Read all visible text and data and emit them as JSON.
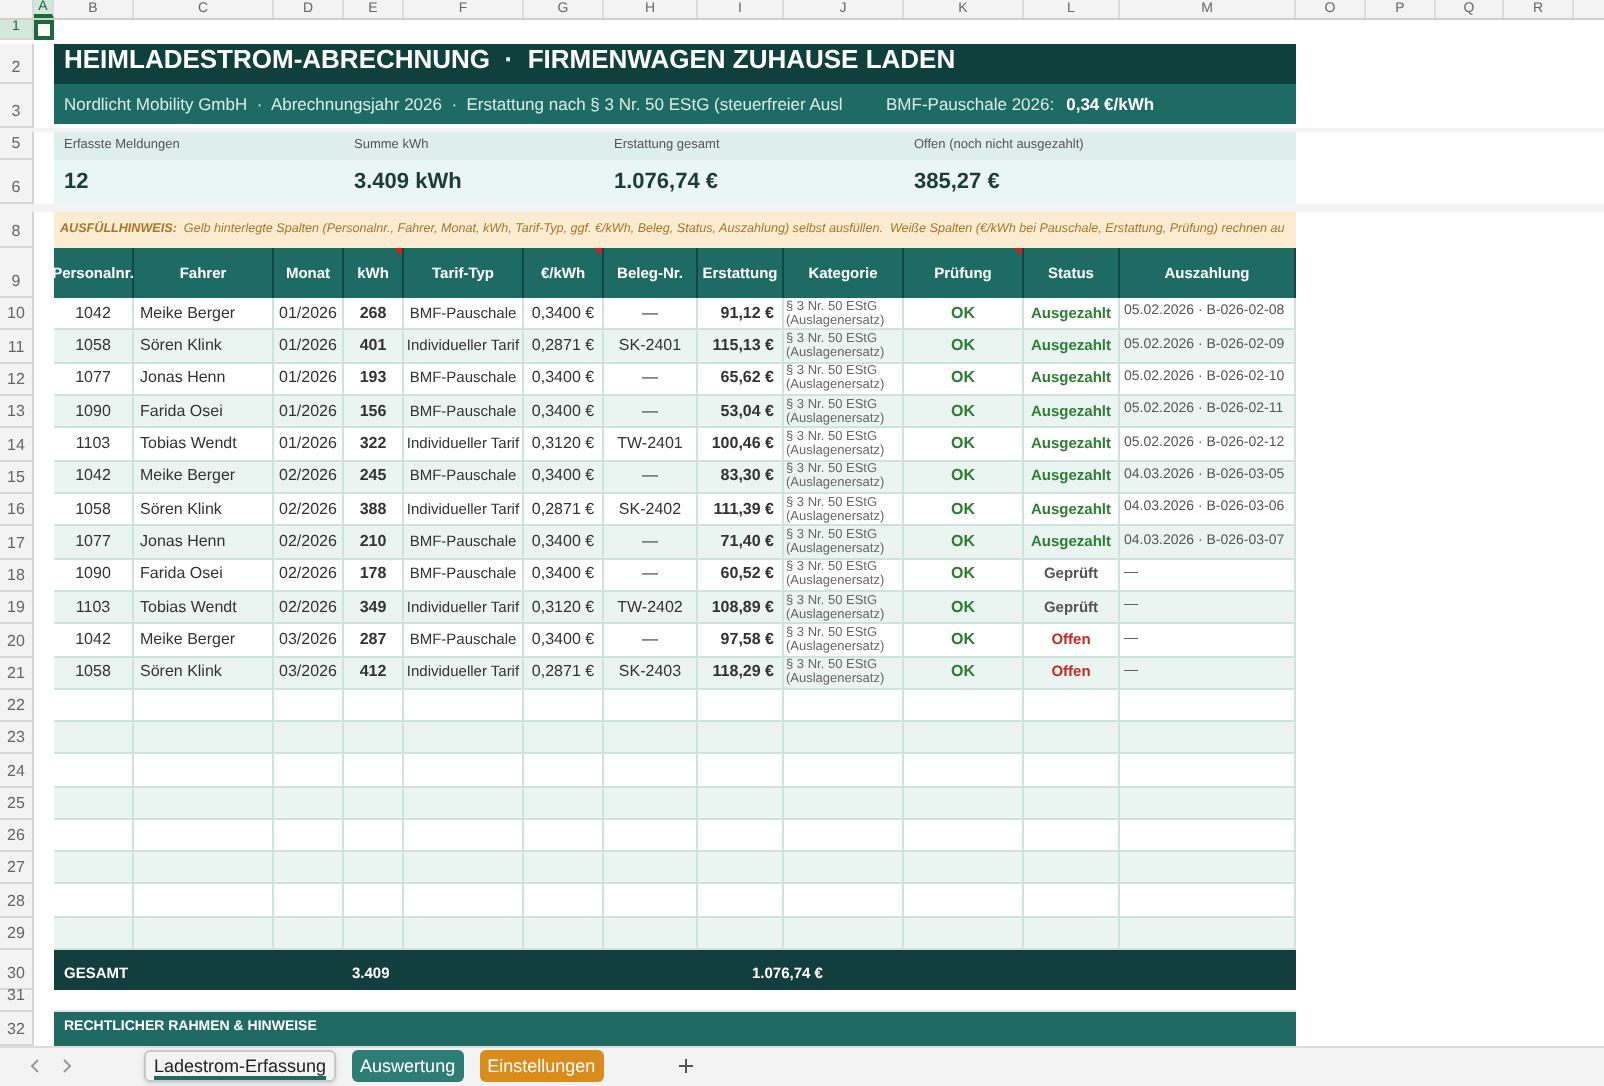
{
  "column_headers": [
    {
      "label": "A",
      "selected": true
    },
    {
      "label": "B",
      "selected": false
    },
    {
      "label": "C",
      "selected": false
    },
    {
      "label": "D",
      "selected": false
    },
    {
      "label": "E",
      "selected": false
    },
    {
      "label": "F",
      "selected": false
    },
    {
      "label": "G",
      "selected": false
    },
    {
      "label": "H",
      "selected": false
    },
    {
      "label": "I",
      "selected": false
    },
    {
      "label": "J",
      "selected": false
    },
    {
      "label": "K",
      "selected": false
    },
    {
      "label": "L",
      "selected": false
    },
    {
      "label": "M",
      "selected": false
    },
    {
      "label": "O",
      "selected": false
    },
    {
      "label": "P",
      "selected": false
    },
    {
      "label": "Q",
      "selected": false
    },
    {
      "label": "R",
      "selected": false
    }
  ],
  "row_1": {
    "number": "1",
    "selected": true
  },
  "title": {
    "row_number": "2",
    "text": "HEIMLADESTROM-ABRECHNUNG  ·  FIRMENWAGEN ZUHAUSE LADEN"
  },
  "subtitle": {
    "row_number": "3",
    "text": "Nordlicht Mobility GmbH  ·  Abrechnungsjahr 2026  ·  Erstattung nach § 3 Nr. 50 EStG (steuerfreier Ausl",
    "rate_label": "BMF-Pauschale 2026:",
    "rate_value": "0,34 €/kWh"
  },
  "kpis": {
    "label_row_number": "5",
    "value_row_number": "6",
    "items": [
      {
        "label": "Erfasste Meldungen",
        "value": "12"
      },
      {
        "label": "Summe kWh",
        "value": "3.409 kWh"
      },
      {
        "label": "Erstattung gesamt",
        "value": "1.076,74 €"
      },
      {
        "label": "Offen (noch nicht ausgezahlt)",
        "value": "385,27 €"
      }
    ]
  },
  "hint": {
    "row_number": "8",
    "text": "**AUSFÜLLHINWEIS:**  Gelb hinterlegte Spalten (Personalnr., Fahrer, Monat, kWh, Tarif-Typ, ggf. €/kWh, Beleg, Status, Auszahlung) selbst ausfüllen.  Weiße Spalten (€/kWh bei Pauschale, Erstattung, Prüfung) rechnen au"
  },
  "table": {
    "header_row_number": "9",
    "columns": [
      {
        "label": "Personalnr.",
        "has_comment": false
      },
      {
        "label": "Fahrer",
        "has_comment": false
      },
      {
        "label": "Monat",
        "has_comment": false
      },
      {
        "label": "kWh",
        "has_comment": true
      },
      {
        "label": "Tarif-Typ",
        "has_comment": false
      },
      {
        "label": "€/kWh",
        "has_comment": true
      },
      {
        "label": "Beleg-Nr.",
        "has_comment": false
      },
      {
        "label": "Erstattung",
        "has_comment": false
      },
      {
        "label": "Kategorie",
        "has_comment": false
      },
      {
        "label": "Prüfung",
        "has_comment": true
      },
      {
        "label": "Status",
        "has_comment": false
      },
      {
        "label": "Auszahlung",
        "has_comment": false
      }
    ],
    "rows": [
      {
        "row_number": "10",
        "cells": [
          "1042",
          "Meike Berger",
          "01/2026",
          "268",
          "BMF-Pauschale",
          "0,3400 €",
          "—",
          "91,12 €",
          "§ 3 Nr. 50 EStG (Auslagenersatz)",
          "OK"
        ],
        "status": {
          "label": "Ausgezahlt",
          "color": "#2e7d32"
        },
        "payout": "05.02.2026 · B-026-02-08"
      },
      {
        "row_number": "11",
        "cells": [
          "1058",
          "Sören Klink",
          "01/2026",
          "401",
          "Individueller Tarif",
          "0,2871 €",
          "SK-2401",
          "115,13 €",
          "§ 3 Nr. 50 EStG (Auslagenersatz)",
          "OK"
        ],
        "status": {
          "label": "Ausgezahlt",
          "color": "#2e7d32"
        },
        "payout": "05.02.2026 · B-026-02-09"
      },
      {
        "row_number": "12",
        "cells": [
          "1077",
          "Jonas Henn",
          "01/2026",
          "193",
          "BMF-Pauschale",
          "0,3400 €",
          "—",
          "65,62 €",
          "§ 3 Nr. 50 EStG (Auslagenersatz)",
          "OK"
        ],
        "status": {
          "label": "Ausgezahlt",
          "color": "#2e7d32"
        },
        "payout": "05.02.2026 · B-026-02-10"
      },
      {
        "row_number": "13",
        "cells": [
          "1090",
          "Farida Osei",
          "01/2026",
          "156",
          "BMF-Pauschale",
          "0,3400 €",
          "—",
          "53,04 €",
          "§ 3 Nr. 50 EStG (Auslagenersatz)",
          "OK"
        ],
        "status": {
          "label": "Ausgezahlt",
          "color": "#2e7d32"
        },
        "payout": "05.02.2026 · B-026-02-11"
      },
      {
        "row_number": "14",
        "cells": [
          "1103",
          "Tobias Wendt",
          "01/2026",
          "322",
          "Individueller Tarif",
          "0,3120 €",
          "TW-2401",
          "100,46 €",
          "§ 3 Nr. 50 EStG (Auslagenersatz)",
          "OK"
        ],
        "status": {
          "label": "Ausgezahlt",
          "color": "#2e7d32"
        },
        "payout": "05.02.2026 · B-026-02-12"
      },
      {
        "row_number": "15",
        "cells": [
          "1042",
          "Meike Berger",
          "02/2026",
          "245",
          "BMF-Pauschale",
          "0,3400 €",
          "—",
          "83,30 €",
          "§ 3 Nr. 50 EStG (Auslagenersatz)",
          "OK"
        ],
        "status": {
          "label": "Ausgezahlt",
          "color": "#2e7d32"
        },
        "payout": "04.03.2026 · B-026-03-05"
      },
      {
        "row_number": "16",
        "cells": [
          "1058",
          "Sören Klink",
          "02/2026",
          "388",
          "Individueller Tarif",
          "0,2871 €",
          "SK-2402",
          "111,39 €",
          "§ 3 Nr. 50 EStG (Auslagenersatz)",
          "OK"
        ],
        "status": {
          "label": "Ausgezahlt",
          "color": "#2e7d32"
        },
        "payout": "04.03.2026 · B-026-03-06"
      },
      {
        "row_number": "17",
        "cells": [
          "1077",
          "Jonas Henn",
          "02/2026",
          "210",
          "BMF-Pauschale",
          "0,3400 €",
          "—",
          "71,40 €",
          "§ 3 Nr. 50 EStG (Auslagenersatz)",
          "OK"
        ],
        "status": {
          "label": "Ausgezahlt",
          "color": "#2e7d32"
        },
        "payout": "04.03.2026 · B-026-03-07"
      },
      {
        "row_number": "18",
        "cells": [
          "1090",
          "Farida Osei",
          "02/2026",
          "178",
          "BMF-Pauschale",
          "0,3400 €",
          "—",
          "60,52 €",
          "§ 3 Nr. 50 EStG (Auslagenersatz)",
          "OK"
        ],
        "status": {
          "label": "Geprüft",
          "color": "#555555"
        },
        "payout": "—"
      },
      {
        "row_number": "19",
        "cells": [
          "1103",
          "Tobias Wendt",
          "02/2026",
          "349",
          "Individueller Tarif",
          "0,3120 €",
          "TW-2402",
          "108,89 €",
          "§ 3 Nr. 50 EStG (Auslagenersatz)",
          "OK"
        ],
        "status": {
          "label": "Geprüft",
          "color": "#555555"
        },
        "payout": "—"
      },
      {
        "row_number": "20",
        "cells": [
          "1042",
          "Meike Berger",
          "03/2026",
          "287",
          "BMF-Pauschale",
          "0,3400 €",
          "—",
          "97,58 €",
          "§ 3 Nr. 50 EStG (Auslagenersatz)",
          "OK"
        ],
        "status": {
          "label": "Offen",
          "color": "#c62828"
        },
        "payout": "—"
      },
      {
        "row_number": "21",
        "cells": [
          "1058",
          "Sören Klink",
          "03/2026",
          "412",
          "Individueller Tarif",
          "0,2871 €",
          "SK-2403",
          "118,29 €",
          "§ 3 Nr. 50 EStG (Auslagenersatz)",
          "OK"
        ],
        "status": {
          "label": "Offen",
          "color": "#c62828"
        },
        "payout": "—"
      }
    ],
    "empty_row_numbers": [
      "22",
      "23",
      "24",
      "25",
      "26",
      "27",
      "28",
      "29"
    ]
  },
  "total": {
    "row_number": "30",
    "label": "GESAMT",
    "kwh": "3.409",
    "amount": "1.076,74 €"
  },
  "row_31": {
    "number": "31"
  },
  "section": {
    "row_number": "32",
    "title": "RECHTLICHER RAHMEN & HINWEISE"
  },
  "sheet_tabs": [
    {
      "label": "Ladestrom-Erfassung",
      "selected": true,
      "color": "#f3f3f3"
    },
    {
      "label": "Auswertung",
      "selected": false,
      "color": "#2e7d74"
    },
    {
      "label": "Einstellungen",
      "selected": false,
      "color": "#d98b1b"
    }
  ]
}
